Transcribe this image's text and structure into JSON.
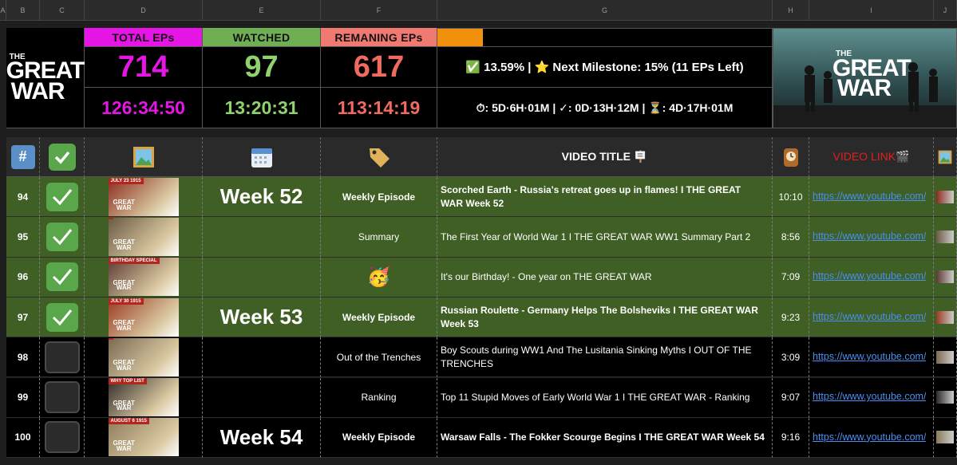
{
  "columns": [
    "A",
    "B",
    "C",
    "D",
    "E",
    "F",
    "G",
    "H",
    "I",
    "J"
  ],
  "summary": {
    "logo": {
      "the": "THE",
      "great": "GREAT",
      "war": "WAR"
    },
    "total": {
      "label": "TOTAL EPs",
      "count": "714",
      "time": "126:34:50",
      "color": "#e516e5",
      "label_bg": "#e516e5"
    },
    "watched": {
      "label": "WATCHED",
      "count": "97",
      "time": "13:20:31",
      "color": "#8fd36e",
      "label_bg": "#6fae52"
    },
    "remaining": {
      "label": "REMANING EPs",
      "count": "617",
      "time": "113:14:19",
      "color": "#f06a60",
      "label_bg": "#f07a72"
    },
    "progress_fraction": 0.1359,
    "progress_color": "#f0900c",
    "progress_text": "✅ 13.59% | ⭐ Next Milestone: 15% (11 EPs Left)",
    "time_text": "⏱: 5D·6H·01M | ✓: 0D·13H·12M | ⏳: 4D·17H·01M"
  },
  "table_header": {
    "num": "#",
    "check_icon": "check-box-icon",
    "thumb_icon": "picture-icon",
    "week_icon": "calendar-icon",
    "tag_icon": "tag-icon",
    "title": "VIDEO TITLE 🪧",
    "duration_icon": "clock-icon",
    "link": "VIDEO LINK🎬",
    "extra_icon": "picture-icon"
  },
  "rows": [
    {
      "num": "94",
      "watched": true,
      "week": "Week 52",
      "type": "Weekly Episode",
      "type_emoji": "",
      "title": "Scorched Earth - Russia's retreat goes up in flames! I THE GREAT WAR Week 52",
      "bold": true,
      "duration": "10:10",
      "link": "https://www.youtube.com/",
      "thumb_text": "JULY 23 1915",
      "thumb_color": "#8a2b1e"
    },
    {
      "num": "95",
      "watched": true,
      "week": "",
      "type": "Summary",
      "type_emoji": "",
      "title": "The First Year of World War 1 I THE GREAT WAR WW1 Summary Part 2",
      "bold": false,
      "duration": "8:56",
      "link": "https://www.youtube.com/",
      "thumb_text": "",
      "thumb_color": "#6b5a45"
    },
    {
      "num": "96",
      "watched": true,
      "week": "",
      "type": "",
      "type_emoji": "🥳",
      "title": "It's our Birthday! - One year on THE GREAT WAR",
      "bold": false,
      "duration": "7:09",
      "link": "https://www.youtube.com/",
      "thumb_text": "BIRTHDAY SPECIAL",
      "thumb_color": "#5b3a34"
    },
    {
      "num": "97",
      "watched": true,
      "week": "Week 53",
      "type": "Weekly Episode",
      "type_emoji": "",
      "title": "Russian Roulette - Germany Helps The Bolsheviks I THE GREAT WAR Week 53",
      "bold": true,
      "duration": "9:23",
      "link": "https://www.youtube.com/",
      "thumb_text": "JULY 30 1915",
      "thumb_color": "#9a3a22"
    },
    {
      "num": "98",
      "watched": false,
      "week": "",
      "type": "Out of the Trenches",
      "type_emoji": "",
      "title": "Boy Scouts during WW1 And The Lusitania Sinking Myths I OUT OF THE TRENCHES",
      "bold": false,
      "duration": "3:09",
      "link": "https://www.youtube.com/",
      "thumb_text": "",
      "thumb_color": "#7a6a52"
    },
    {
      "num": "99",
      "watched": false,
      "week": "",
      "type": "Ranking",
      "type_emoji": "",
      "title": "Top 11 Stupid Moves of Early World War 1 I THE GREAT WAR - Ranking",
      "bold": false,
      "duration": "9:07",
      "link": "https://www.youtube.com/",
      "thumb_text": "WHY TOP LIST",
      "thumb_color": "#2e2a28"
    },
    {
      "num": "100",
      "watched": false,
      "week": "Week 54",
      "type": "Weekly Episode",
      "type_emoji": "",
      "title": "Warsaw Falls - The Fokker Scourge Begins I THE GREAT WAR Week 54",
      "bold": true,
      "duration": "9:16",
      "link": "https://www.youtube.com/",
      "thumb_text": "AUGUST 6 1915",
      "thumb_color": "#8c7a5a"
    }
  ]
}
